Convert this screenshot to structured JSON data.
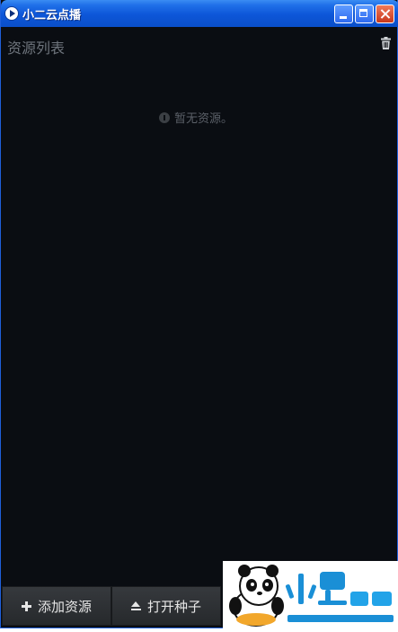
{
  "window": {
    "title": "小二云点播"
  },
  "panel": {
    "title": "资源列表",
    "empty_message": "暂无资源。"
  },
  "footer": {
    "add_label": "添加资源",
    "open_label": "打开种子"
  },
  "watermark": {
    "brand": "小黑游戏",
    "url": "www.xiaohei.com"
  },
  "icons": {
    "app": "play-icon",
    "trash": "trash-icon",
    "info": "info-icon",
    "add": "plus-icon",
    "open": "eject-icon"
  },
  "colors": {
    "titlebar": "#0d56d8",
    "panel_bg": "#0a0d12",
    "muted_text": "#6e747c",
    "button_bg": "#2f3235",
    "close_button": "#c8381b"
  }
}
